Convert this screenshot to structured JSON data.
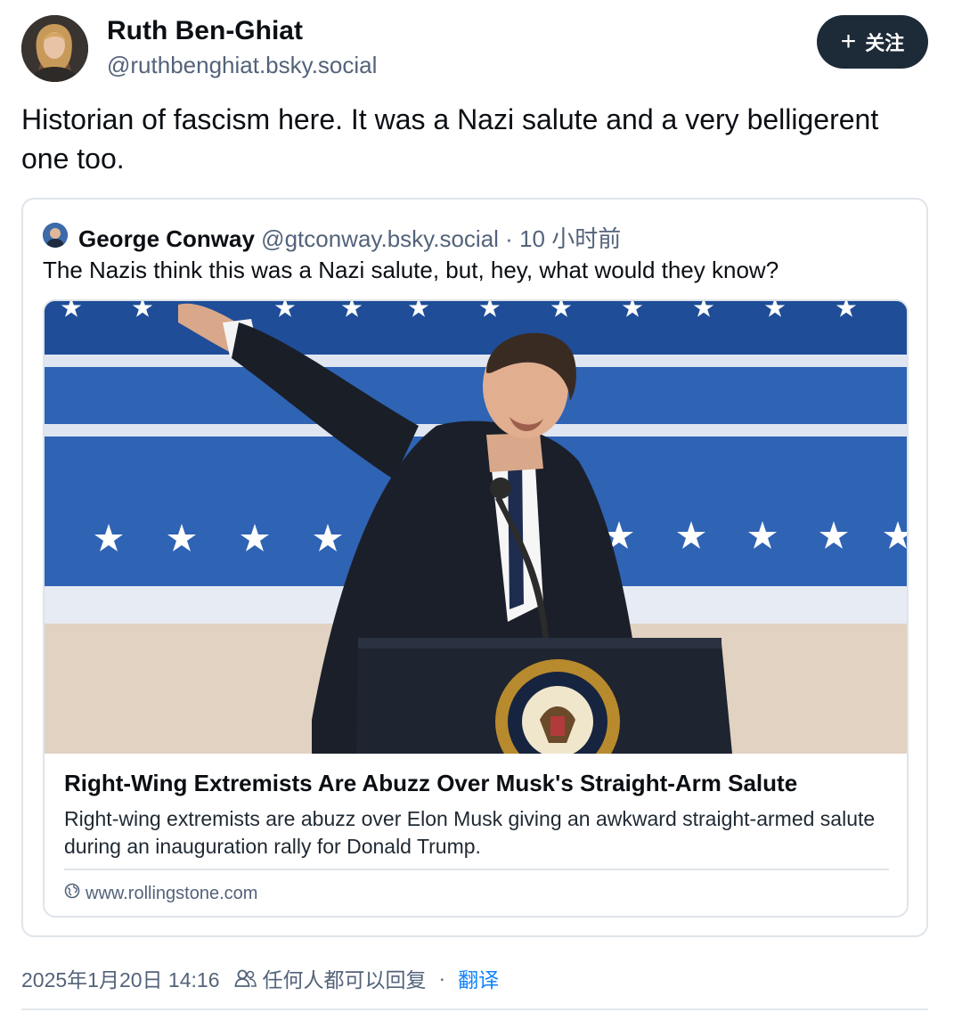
{
  "author": {
    "name": "Ruth Ben-Ghiat",
    "handle": "@ruthbenghiat.bsky.social"
  },
  "follow_button": {
    "icon": "plus-icon",
    "label": "关注"
  },
  "post_text": "Historian of fascism here. It was a Nazi salute and a very belligerent one too.",
  "quoted_post": {
    "author_name": "George Conway",
    "author_handle": "@gtconway.bsky.social",
    "separator": "·",
    "time": "10 小时前",
    "text": "The Nazis think this was a Nazi salute, but, hey, what would they know?",
    "link_card": {
      "title": "Right-Wing Extremists Are Abuzz Over Musk's Straight-Arm Salute",
      "description": "Right-wing extremists are abuzz over Elon Musk giving an awkward straight-armed salute during an inauguration rally for Donald Trump.",
      "domain": "www.rollingstone.com",
      "domain_icon": "globe-icon"
    }
  },
  "footer": {
    "timestamp": "2025年1月20日 14:16",
    "reply_setting_icon": "people-icon",
    "reply_setting": "任何人都可以回复",
    "separator": "·",
    "translate_label": "翻译"
  },
  "colors": {
    "text_primary": "#0b0f14",
    "text_secondary": "#53637a",
    "follow_button_bg": "#1d2a38",
    "link_blue": "#1083fe",
    "border": "#dfe4ea"
  }
}
